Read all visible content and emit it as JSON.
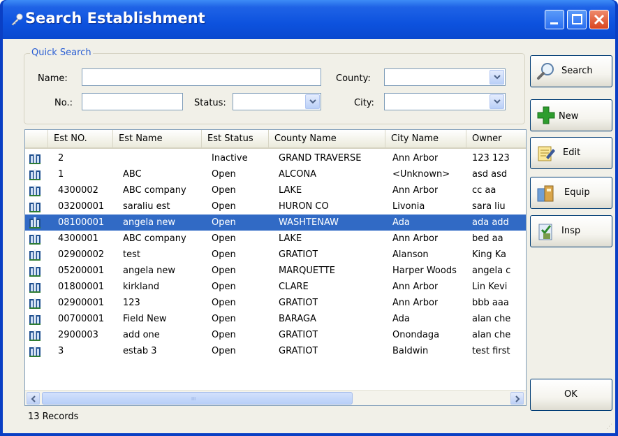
{
  "window": {
    "title": "Search Establishment"
  },
  "quick_search": {
    "legend": "Quick Search",
    "name_label": "Name:",
    "name_value": "",
    "no_label": "No.:",
    "no_value": "",
    "status_label": "Status:",
    "status_value": "",
    "county_label": "County:",
    "county_value": "",
    "city_label": "City:",
    "city_value": ""
  },
  "grid": {
    "columns": [
      "Est NO.",
      "Est Name",
      "Est Status",
      "County Name",
      "City Name",
      "Owner"
    ],
    "rows": [
      {
        "no": "2",
        "name": "",
        "status": "Inactive",
        "county": "GRAND TRAVERSE",
        "city": "Ann Arbor",
        "owner": "123 123"
      },
      {
        "no": "1",
        "name": "ABC",
        "status": "Open",
        "county": "ALCONA",
        "city": "<Unknown>",
        "owner": "asd asd"
      },
      {
        "no": "4300002",
        "name": "ABC company",
        "status": "Open",
        "county": "LAKE",
        "city": "Ann Arbor",
        "owner": "cc aa"
      },
      {
        "no": "03200001",
        "name": "saraliu est",
        "status": "Open",
        "county": "HURON CO",
        "city": "Livonia",
        "owner": "sara liu"
      },
      {
        "no": "08100001",
        "name": "angela new",
        "status": "Open",
        "county": "WASHTENAW",
        "city": "Ada",
        "owner": "ada add"
      },
      {
        "no": "4300001",
        "name": "ABC company",
        "status": "Open",
        "county": "LAKE",
        "city": "Ann Arbor",
        "owner": "bed aa"
      },
      {
        "no": "02900002",
        "name": "test",
        "status": "Open",
        "county": "GRATIOT",
        "city": "Alanson",
        "owner": "King Ka"
      },
      {
        "no": "05200001",
        "name": "angela new",
        "status": "Open",
        "county": "MARQUETTE",
        "city": "Harper Woods",
        "owner": "angela c"
      },
      {
        "no": "01800001",
        "name": "kirkland",
        "status": "Open",
        "county": "CLARE",
        "city": "Ann Arbor",
        "owner": "Lin Kevi"
      },
      {
        "no": "02900001",
        "name": "123",
        "status": "Open",
        "county": "GRATIOT",
        "city": "Ann Arbor",
        "owner": "bbb aaa"
      },
      {
        "no": "00700001",
        "name": "Field New",
        "status": "Open",
        "county": "BARAGA",
        "city": "Ada",
        "owner": "alan che"
      },
      {
        "no": "2900003",
        "name": "add one",
        "status": "Open",
        "county": "GRATIOT",
        "city": "Onondaga",
        "owner": "alan che"
      },
      {
        "no": "3",
        "name": "estab 3",
        "status": "Open",
        "county": "GRATIOT",
        "city": "Baldwin",
        "owner": "test first"
      }
    ],
    "selected_row": 4,
    "scrollbar_grip": "III"
  },
  "status_text": "13 Records",
  "buttons": {
    "search": "Search",
    "new": "New",
    "edit": "Edit",
    "equip": "Equip",
    "insp": "Insp",
    "ok": "OK"
  },
  "icons": {
    "title": "key-icon",
    "row": "building-icon",
    "search": "magnifier-icon",
    "new": "plus-icon",
    "edit": "notepad-pencil-icon",
    "equip": "equipment-icon",
    "insp": "inspection-icon"
  },
  "colors": {
    "titlebar": "#0a49cf",
    "selection": "#316ac5",
    "legend": "#2b5fd3",
    "close_button": "#d9451f"
  }
}
